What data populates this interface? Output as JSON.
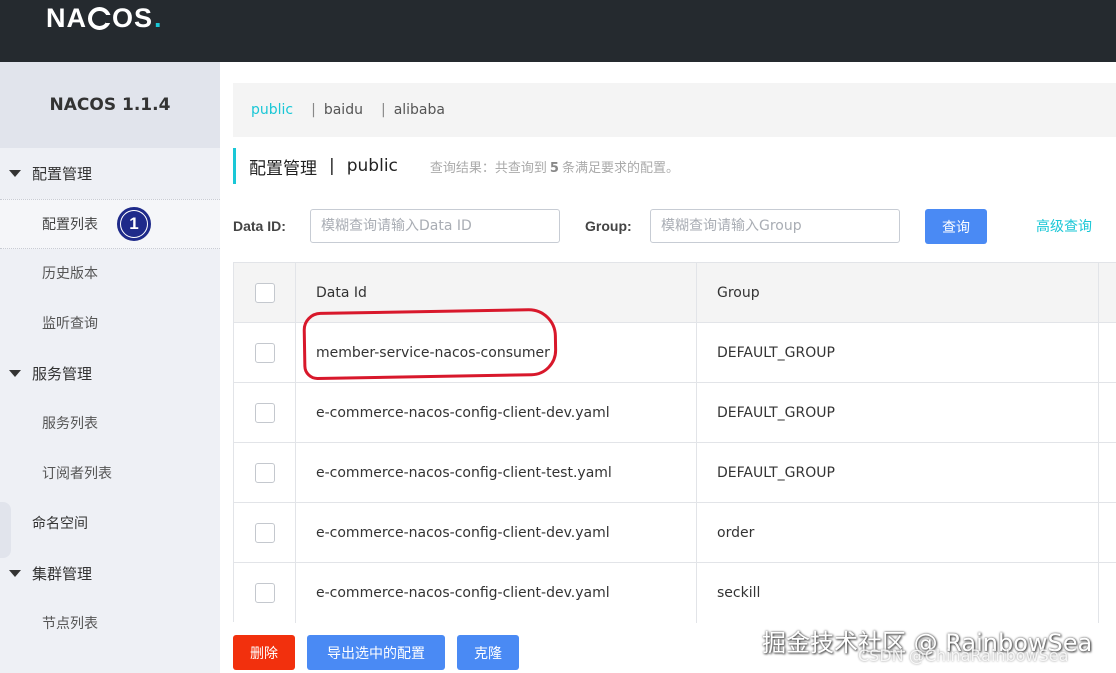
{
  "app": {
    "logo_text_1": "NA",
    "logo_text_2": "OS",
    "logo_dot": ".",
    "version_title": "NACOS 1.1.4",
    "accent_color": "#1ac7d6"
  },
  "sidebar": {
    "groups": [
      {
        "label": "配置管理",
        "items": [
          "配置列表",
          "历史版本",
          "监听查询"
        ]
      },
      {
        "label": "服务管理",
        "items": [
          "服务列表",
          "订阅者列表"
        ]
      },
      {
        "label": "命名空间",
        "items": []
      },
      {
        "label": "集群管理",
        "items": [
          "节点列表"
        ]
      }
    ],
    "active_item": "配置列表",
    "step_badge": "1"
  },
  "namespaces": {
    "items": [
      "public",
      "baidu",
      "alibaba"
    ],
    "active": "public",
    "separator": "|"
  },
  "title": {
    "section": "配置管理",
    "separator": "|",
    "namespace": "public",
    "result_prefix": "查询结果：共查询到",
    "result_count": "5",
    "result_suffix": "条满足要求的配置。"
  },
  "search": {
    "dataid_label": "Data ID:",
    "dataid_placeholder": "模糊查询请输入Data ID",
    "group_label": "Group:",
    "group_placeholder": "模糊查询请输入Group",
    "query_button": "查询",
    "advanced_link": "高级查询"
  },
  "table": {
    "columns": [
      "Data Id",
      "Group"
    ],
    "rows": [
      {
        "data_id": "member-service-nacos-consumer",
        "group": "DEFAULT_GROUP"
      },
      {
        "data_id": "e-commerce-nacos-config-client-dev.yaml",
        "group": "DEFAULT_GROUP"
      },
      {
        "data_id": "e-commerce-nacos-config-client-test.yaml",
        "group": "DEFAULT_GROUP"
      },
      {
        "data_id": "e-commerce-nacos-config-client-dev.yaml",
        "group": "order"
      },
      {
        "data_id": "e-commerce-nacos-config-client-dev.yaml",
        "group": "seckill"
      }
    ]
  },
  "actions": {
    "delete": "删除",
    "export_selected": "导出选中的配置",
    "clone": "克隆"
  },
  "watermark": {
    "main": "掘金技术社区 @ RainbowSea",
    "sub": "CSDN @ChinaRainbowSea"
  }
}
